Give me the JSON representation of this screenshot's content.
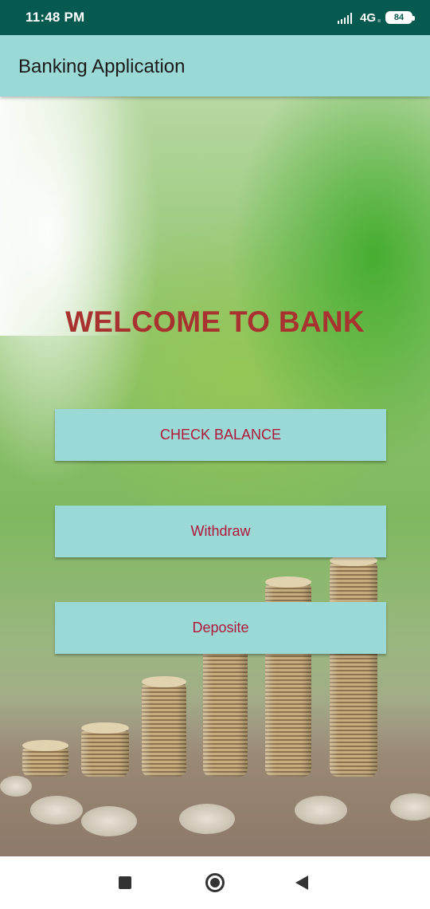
{
  "status_bar": {
    "time": "11:48 PM",
    "network": "4G",
    "network_sub": "ıı",
    "battery": "84",
    "icons": [
      "signal-icon",
      "battery-icon"
    ]
  },
  "app_bar": {
    "title": "Banking Application"
  },
  "main": {
    "welcome": "WELCOME TO BANK",
    "buttons": {
      "check_balance": "CHECK BALANCE",
      "withdraw": "Withdraw",
      "deposit": "Deposite"
    }
  },
  "nav_bar": {
    "icons": [
      "recents-icon",
      "home-icon",
      "back-icon"
    ]
  },
  "colors": {
    "status_bar": "#075a4f",
    "app_bar": "#9bd9d6",
    "button_bg": "#9bd9d6",
    "button_text": "#b0163a",
    "welcome_text": "#a83230"
  }
}
